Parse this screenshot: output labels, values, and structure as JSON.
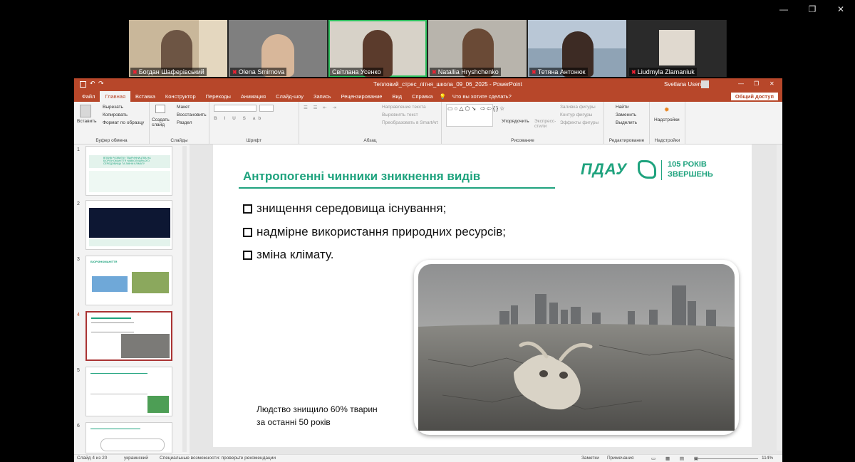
{
  "window_controls": {
    "minimize": "—",
    "maximize": "❐",
    "close": "✕"
  },
  "participants": [
    {
      "name": "Богдан Шаферівський",
      "bg": "#c9b79a",
      "active": false
    },
    {
      "name": "Olena Smirnova",
      "bg": "#8a8a8a",
      "active": false
    },
    {
      "name": "Світлана Усенко",
      "bg": "#d7d2c8",
      "active": true
    },
    {
      "name": "Natallia Hryshchenko",
      "bg": "#b8b4ac",
      "active": false
    },
    {
      "name": "Тетяна Антонюк",
      "bg": "#8fa3b5",
      "active": false
    },
    {
      "name": "Liudmyla Zlamaniuk",
      "bg": "#2a2a2a",
      "active": false
    }
  ],
  "ppt": {
    "doc_title": "Тепловий_стрес_літня_школа_09_06_2025 - PowerPoint",
    "user": "Svetlana Usenko",
    "tabs": [
      "Файл",
      "Главная",
      "Вставка",
      "Конструктор",
      "Переходы",
      "Анимация",
      "Слайд-шоу",
      "Запись",
      "Рецензирование",
      "Вид",
      "Справка"
    ],
    "tell_me": "Что вы хотите сделать?",
    "share": "Общий доступ",
    "ribbon": {
      "paste": "Вставить",
      "cut": "Вырезать",
      "copy": "Копировать",
      "format_painter": "Формат по образцу",
      "clipboard": "Буфер обмена",
      "new_slide": "Создать слайд",
      "layout": "Макет",
      "reset": "Восстановить",
      "section": "Раздел",
      "slides": "Слайды",
      "font": "Шрифт",
      "text_direction": "Направление текста",
      "align_text": "Выровнять текст",
      "smartart": "Преобразовать в SmartArt",
      "paragraph": "Абзац",
      "arrange": "Упорядочить",
      "quick_styles": "Экспресс-стили",
      "shape_fill": "Заливка фигуры",
      "shape_outline": "Контур фигуры",
      "shape_effects": "Эффекты фигуры",
      "drawing": "Рисование",
      "find": "Найти",
      "replace": "Заменить",
      "select": "Выделить",
      "editing": "Редактирование",
      "addins": "Надстройки",
      "addins_group": "Надстройки"
    },
    "status": {
      "slide": "Слайд 4 из 20",
      "lang": "украинский",
      "accessibility": "Специальные возможности: проверьте рекомендации",
      "notes": "Заметки",
      "comments": "Примечания",
      "zoom": "114%"
    }
  },
  "thumbnails": [
    "1",
    "2",
    "3",
    "4",
    "5",
    "6"
  ],
  "thumb1_title": "ВПЛИВ РОЗВИТКУ ТВАРИННИЦТВА НА БІОРІЗНОМАНІТТЯ НАВКОЛИШНЬОГО СЕРЕДОВИЩА ТА ЗМІНИ КЛІМАТУ",
  "thumb3_title": "БІОРІЗНОМАНІТТЯ",
  "slide": {
    "title": "Антропогенні чинники зникнення видів",
    "logo": "ПДАУ",
    "anniversary_line1": "105 РОКІВ",
    "anniversary_line2": "ЗВЕРШЕНЬ",
    "bullets": [
      "знищення середовища існування;",
      "надмірне використання природних ресурсів;",
      "зміна клімату."
    ],
    "caption_line1": "Людство знищило 60% тварин",
    "caption_line2": "за останні 50 років",
    "accent": "#1fa37e"
  }
}
